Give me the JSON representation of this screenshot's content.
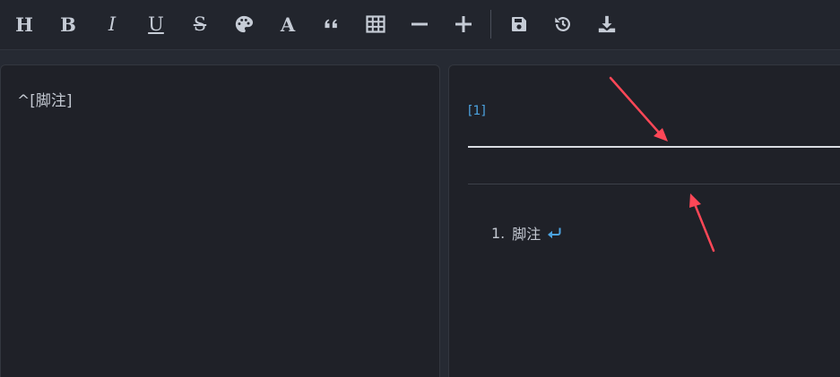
{
  "toolbar": {
    "heading_label": "H",
    "bold_label": "B",
    "italic_label": "I",
    "underline_label": "U",
    "strike_label": "S",
    "color_label": "A",
    "icons": [
      "heading-icon",
      "bold-icon",
      "italic-icon",
      "underline-icon",
      "strikethrough-icon",
      "palette-icon",
      "font-color-icon",
      "quote-icon",
      "table-icon",
      "minus-icon",
      "plus-icon",
      "save-icon",
      "history-icon",
      "download-icon"
    ]
  },
  "editor": {
    "source_text": "^[脚注]"
  },
  "preview": {
    "footnote_ref": "[1]",
    "footnotes": [
      {
        "number": "1.",
        "text": "脚注",
        "backref_icon": "return-arrow-icon"
      }
    ]
  },
  "colors": {
    "toolbar_bg": "#22252d",
    "pane_bg": "#1f2128",
    "text": "#c3c8d1",
    "accent": "#4ca3e0",
    "annotation": "#ff4757"
  }
}
